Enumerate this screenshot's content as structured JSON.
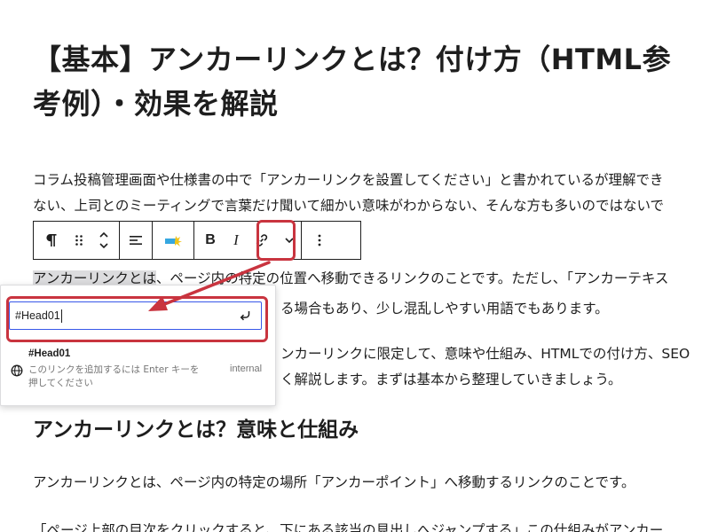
{
  "page": {
    "title": "【基本】アンカーリンクとは？付け方（HTML参考例）・効果を解説",
    "para1_line1": "コラム投稿管理画面や仕様書の中で「アンカーリンクを設置してください」と書かれているが理解でき",
    "para1_line2": "ない、上司とのミーティングで言葉だけ聞いて細かい意味がわからない、そんな方も多いのではないで",
    "para2_line1_selected": "アンカーリンクとは",
    "para2_line1_rest": "、ページ内の特定の位置へ移動できるリンクのことです。ただし、「アンカーテキス",
    "para2_line2_visible": "る場合もあり、少し混乱しやすい用語でもあります。",
    "para3_line1_visible": "ンカーリンクに限定して、意味や仕組み、HTMLでの付け方、SEO",
    "para3_line2_visible": "く解説します。まずは基本から整理していきましょう。",
    "heading2": "アンカーリンクとは？意味と仕組み",
    "para4": "アンカーリンクとは、ページ内の特定の場所「アンカーポイント」へ移動するリンクのことです。",
    "para5": "「ページ上部の目次をクリックすると、下にある該当の見出しへジャンプする」この仕組みがアンカー"
  },
  "toolbar": {
    "paragraph_icon": "pilcrow-icon",
    "drag_icon": "drag-handle-icon",
    "move_icon": "move-up-down-icon",
    "align_icon": "align-left-icon",
    "highlight_icon": "highlighter-icon",
    "bold_label": "B",
    "italic_label": "I",
    "link_icon": "link-icon",
    "more_icon": "chevron-down-icon",
    "options_icon": "more-vertical-icon"
  },
  "link_popover": {
    "input_value": "#Head01",
    "suggestion_title": "#Head01",
    "suggestion_desc": "このリンクを追加するには Enter キーを押してください",
    "suggestion_type": "internal"
  },
  "colors": {
    "annotation_red": "#c9343f",
    "input_focus": "#3858e9",
    "selection": "#dcdcde"
  }
}
